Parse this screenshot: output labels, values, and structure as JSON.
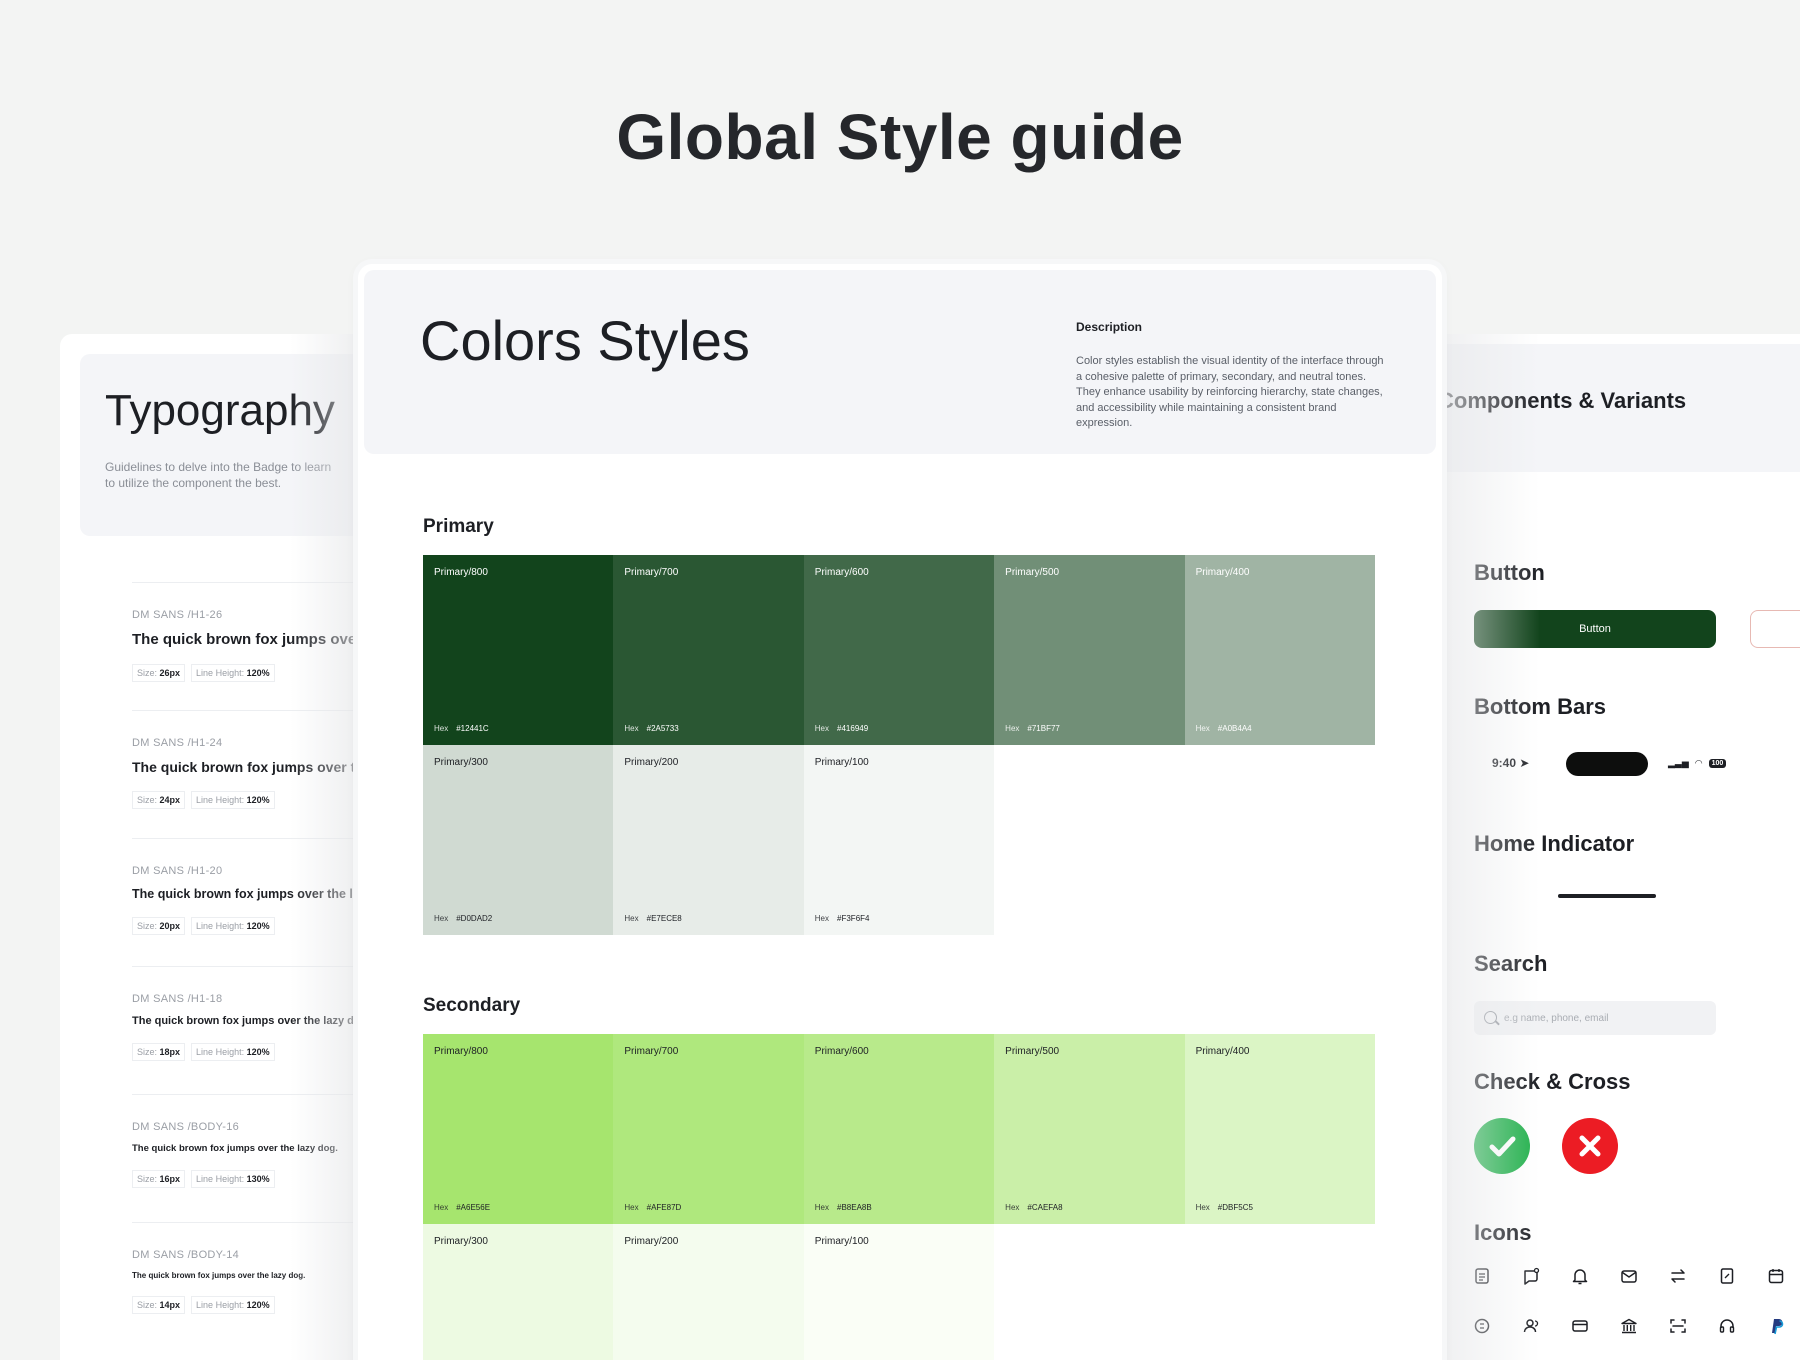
{
  "page": {
    "title": "Global Style guide"
  },
  "typography": {
    "title": "Typography",
    "description_line1": "Guidelines to delve into the Badge to learn",
    "description_line2": "to utilize the component the best.",
    "items": [
      {
        "label": "DM SANS /H1-26",
        "sample": "The quick brown fox jumps over th",
        "size_label": "Size:",
        "size": "26px",
        "lh_label": "Line Height:",
        "lh": "120%"
      },
      {
        "label": "DM SANS /H1-24",
        "sample": "The quick brown fox jumps over the la",
        "size_label": "Size:",
        "size": "24px",
        "lh_label": "Line Height:",
        "lh": "120%"
      },
      {
        "label": "DM SANS /H1-20",
        "sample": "The quick brown fox jumps over the lazy dog.",
        "size_label": "Size:",
        "size": "20px",
        "lh_label": "Line Height:",
        "lh": "120%"
      },
      {
        "label": "DM SANS /H1-18",
        "sample": "The quick brown fox jumps over the lazy dog.",
        "size_label": "Size:",
        "size": "18px",
        "lh_label": "Line Height:",
        "lh": "120%"
      },
      {
        "label": "DM SANS /BODY-16",
        "sample": "The quick brown fox jumps over the lazy dog.",
        "size_label": "Size:",
        "size": "16px",
        "lh_label": "Line Height:",
        "lh": "130%"
      },
      {
        "label": "DM SANS /BODY-14",
        "sample": "The quick brown fox jumps over the lazy dog.",
        "size_label": "Size:",
        "size": "14px",
        "lh_label": "Line Height:",
        "lh": "120%"
      }
    ]
  },
  "colors": {
    "title": "Colors Styles",
    "description_label": "Description",
    "description": "Color styles establish the visual identity of the interface through a cohesive palette of primary, secondary, and neutral tones. They enhance usability by reinforcing hierarchy, state changes, and accessibility while maintaining a consistent brand expression.",
    "hex_label": "Hex",
    "primary": {
      "label": "Primary",
      "swatches": [
        {
          "name": "Primary/800",
          "hex": "#12441C",
          "color": "#12441C",
          "text": "#ffffff"
        },
        {
          "name": "Primary/700",
          "hex": "#2A5733",
          "color": "#2A5733",
          "text": "#ffffff"
        },
        {
          "name": "Primary/600",
          "hex": "#416949",
          "color": "#416949",
          "text": "#ffffff"
        },
        {
          "name": "Primary/500",
          "hex": "#71BF77",
          "color": "#718F77",
          "text": "#ffffff"
        },
        {
          "name": "Primary/400",
          "hex": "#A0B4A4",
          "color": "#A0B4A4",
          "text": "#ffffff"
        },
        {
          "name": "Primary/300",
          "hex": "#D0DAD2",
          "color": "#D0DAD2",
          "text": "#1d1f24"
        },
        {
          "name": "Primary/200",
          "hex": "#E7ECE8",
          "color": "#E7ECE8",
          "text": "#1d1f24"
        },
        {
          "name": "Primary/100",
          "hex": "#F3F6F4",
          "color": "#F3F6F4",
          "text": "#1d1f24"
        }
      ]
    },
    "secondary": {
      "label": "Secondary",
      "swatches": [
        {
          "name": "Primary/800",
          "hex": "#A6E56E",
          "color": "#A6E56E",
          "text": "#1d1f24"
        },
        {
          "name": "Primary/700",
          "hex": "#AFE87D",
          "color": "#AFE87D",
          "text": "#1d1f24"
        },
        {
          "name": "Primary/600",
          "hex": "#B8EA8B",
          "color": "#B8EA8B",
          "text": "#1d1f24"
        },
        {
          "name": "Primary/500",
          "hex": "#CAEFA8",
          "color": "#CAEFA8",
          "text": "#1d1f24"
        },
        {
          "name": "Primary/400",
          "hex": "#DBF5C5",
          "color": "#DBF5C5",
          "text": "#1d1f24"
        },
        {
          "name": "Primary/300",
          "hex": "",
          "color": "#EDFAE2",
          "text": "#1d1f24"
        },
        {
          "name": "Primary/200",
          "hex": "",
          "color": "#F4FCEE",
          "text": "#1d1f24"
        },
        {
          "name": "Primary/100",
          "hex": "",
          "color": "#FAFEF6",
          "text": "#1d1f24"
        }
      ]
    }
  },
  "components": {
    "title": "Components & Variants",
    "button_section": "Button",
    "button_label": "Button",
    "bottom_bars_section": "Bottom Bars",
    "status_time": "9:40",
    "battery": "100",
    "home_indicator_section": "Home Indicator",
    "search_section": "Search",
    "search_placeholder": "e.g name, phone, email",
    "check_cross_section": "Check & Cross",
    "icons_section": "Icons",
    "check_color": "#22B14C",
    "cross_color": "#EC1C24",
    "button_color": "#12441C",
    "icons": [
      "document-icon",
      "chat-icon",
      "bell-icon",
      "mail-icon",
      "transfer-icon",
      "receipt-icon",
      "calendar-icon",
      "coin-icon",
      "users-icon",
      "card-icon",
      "bank-icon",
      "scan-icon",
      "headset-icon",
      "paypal-icon"
    ]
  }
}
